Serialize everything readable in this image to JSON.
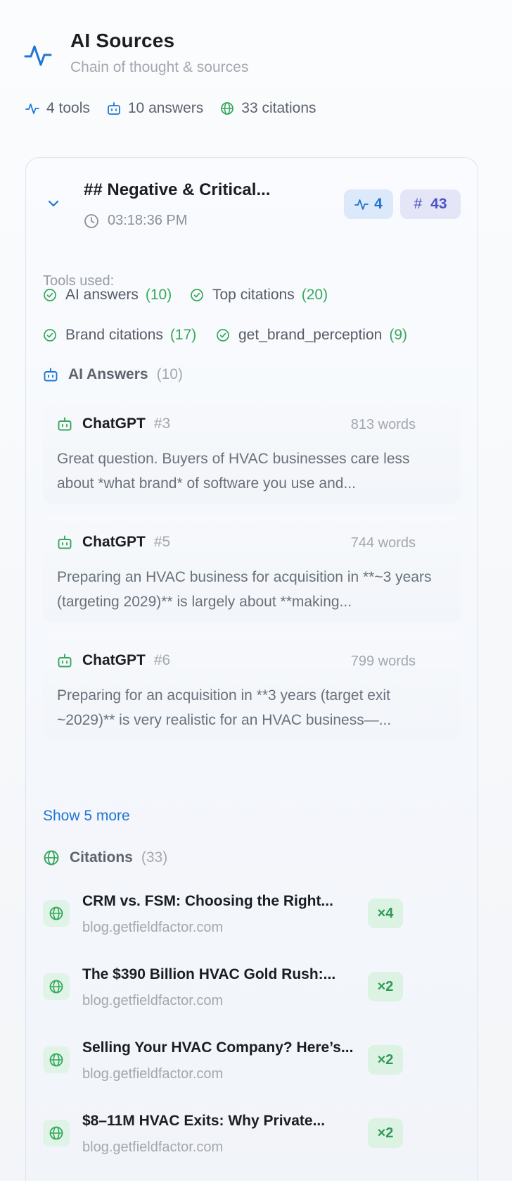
{
  "header": {
    "title": "AI Sources",
    "subtitle": "Chain of thought & sources",
    "stats": {
      "tools": "4 tools",
      "answers": "10 answers",
      "citations": "33 citations"
    }
  },
  "card": {
    "title": "## Negative & Critical...",
    "time": "03:18:36 PM",
    "tools_count": "4",
    "citations_count": "43",
    "tools_label": "Tools used:",
    "tools": [
      {
        "name": "AI answers",
        "count": "(10)"
      },
      {
        "name": "Top citations",
        "count": "(20)"
      },
      {
        "name": "Brand citations",
        "count": "(17)"
      },
      {
        "name": "get_brand_perception",
        "count": "(9)"
      }
    ],
    "answers_section": {
      "label": "AI Answers",
      "count": "(10)"
    },
    "answers": [
      {
        "model": "ChatGPT",
        "num": "#3",
        "words": "813 words",
        "text": "Great question. Buyers of HVAC businesses care less about *what brand* of software you use and..."
      },
      {
        "model": "ChatGPT",
        "num": "#5",
        "words": "744 words",
        "text": "Preparing an HVAC business for acquisition in **~3 years (targeting 2029)** is largely about **making..."
      },
      {
        "model": "ChatGPT",
        "num": "#6",
        "words": "799 words",
        "text": "Preparing for an acquisition in **3 years (target exit ~2029)** is very realistic for an HVAC business—..."
      }
    ],
    "show_more": "Show 5 more",
    "citations_section": {
      "label": "Citations",
      "count": "(33)"
    },
    "citations": [
      {
        "title": "CRM vs. FSM: Choosing the Right...",
        "domain": "blog.getfieldfactor.com",
        "badge": "×4"
      },
      {
        "title": "The $390 Billion HVAC Gold Rush:...",
        "domain": "blog.getfieldfactor.com",
        "badge": "×2"
      },
      {
        "title": "Selling Your HVAC Company? Here’s...",
        "domain": "blog.getfieldfactor.com",
        "badge": "×2"
      },
      {
        "title": "$8–11M HVAC Exits: Why Private...",
        "domain": "blog.getfieldfactor.com",
        "badge": "×2"
      }
    ]
  },
  "colors": {
    "accent": "#1f76d3",
    "success": "#35a85a",
    "indigo": "#4b54c6"
  },
  "icons": [
    "activity-icon",
    "bot-icon",
    "globe-icon",
    "chevron-down-icon",
    "clock-icon",
    "hash-icon",
    "check-circle-icon"
  ]
}
